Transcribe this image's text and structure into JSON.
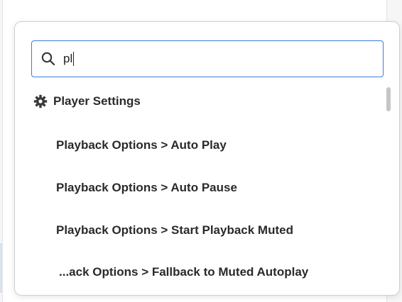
{
  "search": {
    "value": "pl",
    "icon": "search-icon"
  },
  "group": {
    "label": "Player Settings",
    "icon": "gear-icon"
  },
  "results": [
    "Playback Options > Auto Play",
    "Playback Options > Auto Pause",
    "Playback Options > Start Playback Muted",
    "...ack Options > Fallback to Muted Autoplay"
  ],
  "colors": {
    "focus_border": "#3b7dd8",
    "text": "#2a2a2a",
    "scrollbar": "#c6c6c8"
  }
}
